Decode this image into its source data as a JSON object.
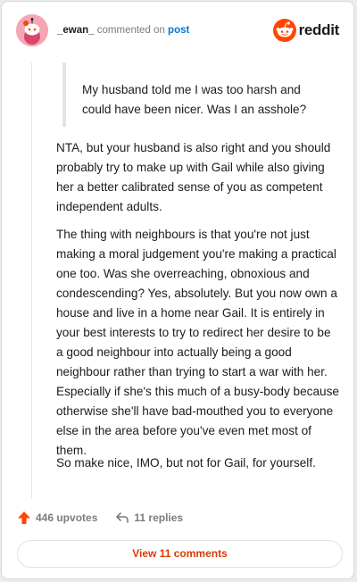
{
  "header": {
    "username": "_ewan_",
    "commented_on": "commented on",
    "post_link": "post",
    "logo_text": "reddit"
  },
  "comment": {
    "quote": "My husband told me I was too harsh and could have been nicer. Was I an asshole?",
    "paragraphs": [
      "NTA, but your husband is also right and you should probably try to make up with Gail while also giving her a better calibrated sense of you as competent independent adults.",
      "The thing with neighbours is that you're not just making a moral judgement you're making a practical one too. Was she overreaching, obnoxious and condescending? Yes, absolutely. But you now own a house and live in a home near Gail. It is entirely in your best interests to try to redirect her desire to be a good neighbour into actually being a good neighbour rather than trying to start a war with her. Especially if she's this much of a busy-body because otherwise she'll have bad-mouthed you to everyone else in the area before you've even met most of them.",
      "So make nice, IMO, but not for Gail, for yourself."
    ]
  },
  "actions": {
    "upvotes": "446 upvotes",
    "replies": "11 replies",
    "view_comments": "View 11 comments"
  },
  "colors": {
    "accent": "#ff4500",
    "link": "#0079d3",
    "button_text": "#d93a00",
    "avatar_bg": "#f4a6b4"
  },
  "icons": [
    "snoo-avatar-icon",
    "reddit-logo-icon",
    "upvote-arrow-icon",
    "reply-icon"
  ]
}
